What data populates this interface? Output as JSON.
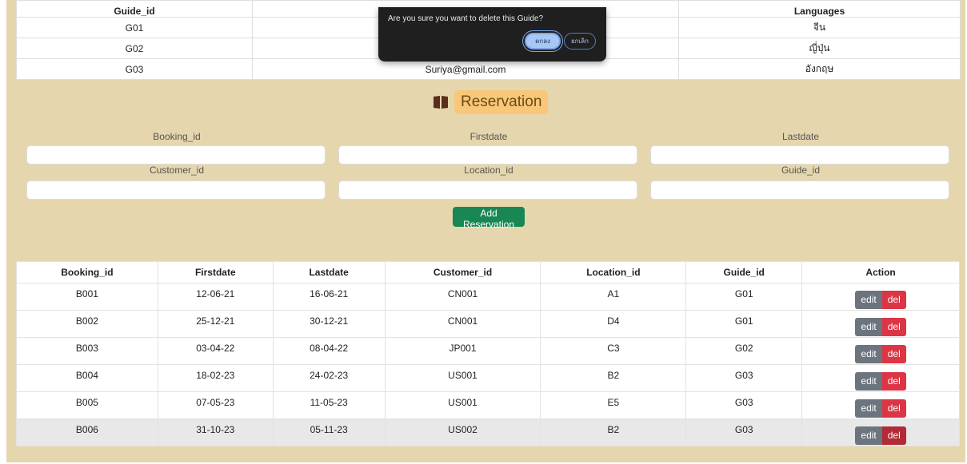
{
  "guide_table": {
    "headers": [
      "Guide_id",
      "",
      "Languages"
    ],
    "rows": [
      [
        "G01",
        "",
        "จีน"
      ],
      [
        "G02",
        "",
        "ญี่ปุ่น"
      ],
      [
        "G03",
        "Suriya@gmail.com",
        "อังกฤษ"
      ]
    ]
  },
  "reservation": {
    "title": "Reservation",
    "icon": "book-icon",
    "form_labels": [
      "Booking_id",
      "Firstdate",
      "Lastdate",
      "Customer_id",
      "Location_id",
      "Guide_id"
    ],
    "add_button": "Add Reservation"
  },
  "reservation_table": {
    "headers": [
      "Booking_id",
      "Firstdate",
      "Lastdate",
      "Customer_id",
      "Location_id",
      "Guide_id",
      "Action"
    ],
    "rows": [
      [
        "B001",
        "12-06-21",
        "16-06-21",
        "CN001",
        "A1",
        "G01"
      ],
      [
        "B002",
        "25-12-21",
        "30-12-21",
        "CN001",
        "D4",
        "G01"
      ],
      [
        "B003",
        "03-04-22",
        "08-04-22",
        "JP001",
        "C3",
        "G02"
      ],
      [
        "B004",
        "18-02-23",
        "24-02-23",
        "US001",
        "B2",
        "G03"
      ],
      [
        "B005",
        "07-05-23",
        "11-05-23",
        "US001",
        "E5",
        "G03"
      ],
      [
        "B006",
        "31-10-23",
        "05-11-23",
        "US002",
        "B2",
        "G03"
      ]
    ],
    "edit_label": "edit",
    "del_label": "del"
  },
  "dialog": {
    "message": "Are you sure you want to delete this Guide?",
    "ok_label": "ตกลง",
    "cancel_label": "ยกเลิก"
  },
  "colors": {
    "background": "#e5d6ad",
    "title_badge": "#f8c77a",
    "add_button": "#198754",
    "edit_button": "#6c757d",
    "del_button": "#dc3545",
    "dialog_bg": "#1f1f1f"
  }
}
